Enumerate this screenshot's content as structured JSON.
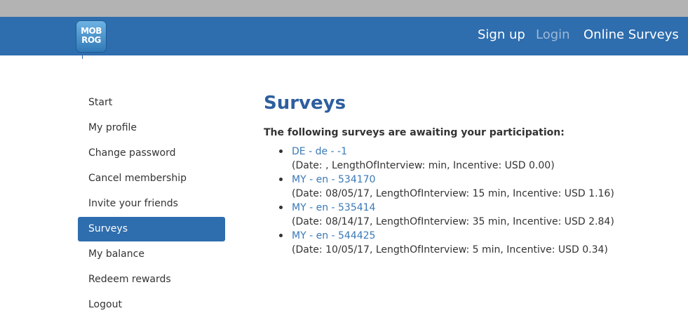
{
  "header": {
    "logo": {
      "line1": "MOB",
      "line2": "ROG"
    },
    "nav": [
      {
        "label": "Sign up"
      },
      {
        "label": "Login"
      },
      {
        "label": "Online Surveys"
      }
    ]
  },
  "sidebar": {
    "items": [
      {
        "label": "Start"
      },
      {
        "label": "My profile"
      },
      {
        "label": "Change password"
      },
      {
        "label": "Cancel membership"
      },
      {
        "label": "Invite your friends"
      },
      {
        "label": "Surveys",
        "active": true
      },
      {
        "label": "My balance"
      },
      {
        "label": "Redeem rewards"
      },
      {
        "label": "Logout"
      }
    ]
  },
  "main": {
    "title": "Surveys",
    "intro": "The following surveys are awaiting your participation:",
    "surveys": [
      {
        "link": "DE - de - -1",
        "details": "(Date: , LengthOfInterview: min, Incentive: USD 0.00)"
      },
      {
        "link": "MY - en - 534170",
        "details": "(Date: 08/05/17, LengthOfInterview: 15 min, Incentive: USD 1.16)"
      },
      {
        "link": "MY - en - 535414",
        "details": "(Date: 08/14/17, LengthOfInterview: 35 min, Incentive: USD 2.84)"
      },
      {
        "link": "MY - en - 544425",
        "details": "(Date: 10/05/17, LengthOfInterview: 5 min, Incentive: USD 0.34)"
      }
    ]
  },
  "colors": {
    "brand": "#2e6dae",
    "title": "#2e5f9e",
    "link": "#3a79b7",
    "topstrip": "#b3b3b3"
  }
}
